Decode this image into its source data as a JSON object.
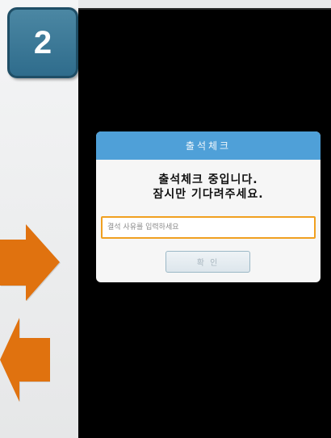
{
  "step_badge": {
    "number": "2"
  },
  "arrows": [
    {
      "icon": "arrow-right-icon",
      "color": "#e0720f"
    },
    {
      "icon": "arrow-left-icon",
      "color": "#e0720f"
    }
  ],
  "dialog": {
    "title": "출석체크",
    "message_line1": "출석체크 중입니다.",
    "message_line2": "잠시만 기다려주세요.",
    "input_placeholder": "결석 사유를 입력하세요",
    "input_value": "",
    "confirm_label": "확 인"
  },
  "colors": {
    "accent_header": "#4fa0d8",
    "input_border": "#f0a020",
    "badge": "#3a7898",
    "arrow": "#e0720f"
  }
}
